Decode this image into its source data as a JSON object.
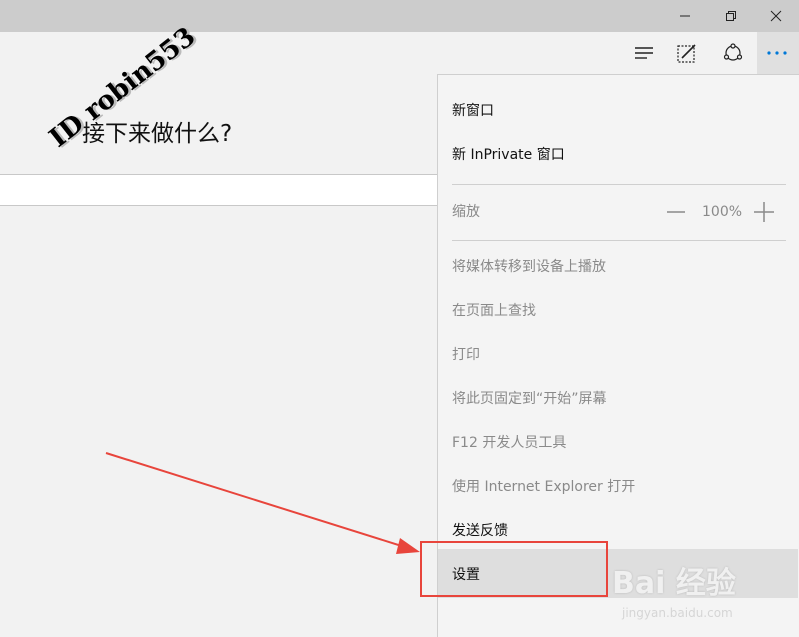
{
  "window": {
    "minimize_icon": "minimize-icon",
    "restore_icon": "restore-icon",
    "close_icon": "close-icon"
  },
  "toolbar": {
    "hub_icon": "hub-icon",
    "web_note_icon": "web-note-icon",
    "share_icon": "share-icon",
    "more_icon": "more-actions-icon"
  },
  "page": {
    "headline": "接下来做什么?",
    "watermark": "ID robin553"
  },
  "menu": {
    "new_window": "新窗口",
    "new_inprivate": "新 InPrivate 窗口",
    "zoom_label": "缩放",
    "zoom_value": "100%",
    "cast_media": "将媒体转移到设备上播放",
    "find_on_page": "在页面上查找",
    "print": "打印",
    "pin_to_start": "将此页固定到“开始”屏幕",
    "f12_tools": "F12 开发人员工具",
    "open_with_ie": "使用 Internet Explorer 打开",
    "send_feedback": "发送反馈",
    "settings": "设置"
  },
  "watermark_site": {
    "brand": "Bai 经验",
    "url": "jingyan.baidu.com"
  },
  "colors": {
    "accent": "#0078d7",
    "annotation": "#e8453c"
  }
}
